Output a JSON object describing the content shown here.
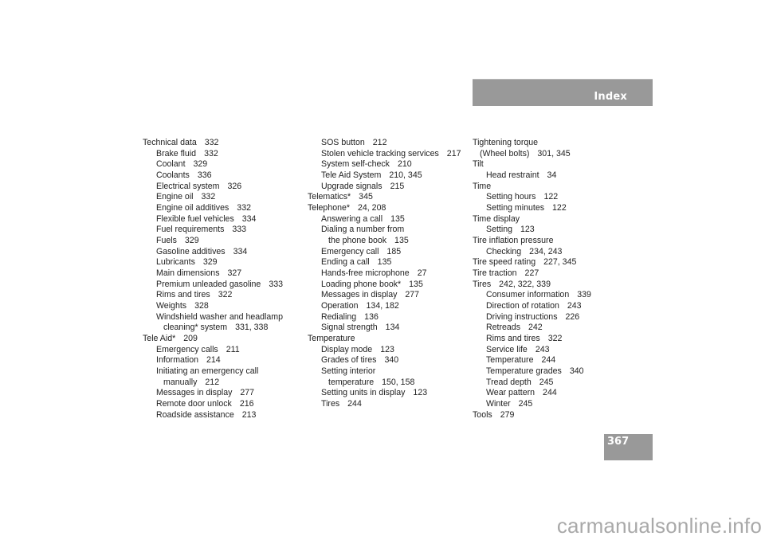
{
  "header": {
    "title": "Index"
  },
  "page_number": "367",
  "watermark": "carmanualsonline.info",
  "columns": [
    [
      {
        "level": 0,
        "text": "Technical data",
        "pages": "332"
      },
      {
        "level": 1,
        "text": "Brake fluid",
        "pages": "332"
      },
      {
        "level": 1,
        "text": "Coolant",
        "pages": "329"
      },
      {
        "level": 1,
        "text": "Coolants",
        "pages": "336"
      },
      {
        "level": 1,
        "text": "Electrical system",
        "pages": "326"
      },
      {
        "level": 1,
        "text": "Engine oil",
        "pages": "332"
      },
      {
        "level": 1,
        "text": "Engine oil additives",
        "pages": "332"
      },
      {
        "level": 1,
        "text": "Flexible fuel vehicles",
        "pages": "334"
      },
      {
        "level": 1,
        "text": "Fuel requirements",
        "pages": "333"
      },
      {
        "level": 1,
        "text": "Fuels",
        "pages": "329"
      },
      {
        "level": 1,
        "text": "Gasoline additives",
        "pages": "334"
      },
      {
        "level": 1,
        "text": "Lubricants",
        "pages": "329"
      },
      {
        "level": 1,
        "text": "Main dimensions",
        "pages": "327"
      },
      {
        "level": 1,
        "text": "Premium unleaded gasoline",
        "pages": "333"
      },
      {
        "level": 1,
        "text": "Rims and tires",
        "pages": "322"
      },
      {
        "level": 1,
        "text": "Weights",
        "pages": "328"
      },
      {
        "level": 1,
        "text": "Windshield washer and headlamp",
        "pages": ""
      },
      {
        "level": 2,
        "text": "cleaning* system",
        "pages": "331, 338"
      },
      {
        "level": 0,
        "text": "Tele Aid*",
        "pages": "209"
      },
      {
        "level": 1,
        "text": "Emergency calls",
        "pages": "211"
      },
      {
        "level": 1,
        "text": "Information",
        "pages": "214"
      },
      {
        "level": 1,
        "text": "Initiating an emergency call",
        "pages": ""
      },
      {
        "level": 2,
        "text": "manually",
        "pages": "212"
      },
      {
        "level": 1,
        "text": "Messages in display",
        "pages": "277"
      },
      {
        "level": 1,
        "text": "Remote door unlock",
        "pages": "216"
      },
      {
        "level": 1,
        "text": "Roadside assistance",
        "pages": "213"
      }
    ],
    [
      {
        "level": 1,
        "text": "SOS button",
        "pages": "212"
      },
      {
        "level": 1,
        "text": "Stolen vehicle tracking services",
        "pages": "217"
      },
      {
        "level": 1,
        "text": "System self-check",
        "pages": "210"
      },
      {
        "level": 1,
        "text": "Tele Aid System",
        "pages": "210, 345"
      },
      {
        "level": 1,
        "text": "Upgrade signals",
        "pages": "215"
      },
      {
        "level": 0,
        "text": "Telematics*",
        "pages": "345"
      },
      {
        "level": 0,
        "text": "Telephone*",
        "pages": "24, 208"
      },
      {
        "level": 1,
        "text": "Answering a call",
        "pages": "135"
      },
      {
        "level": 1,
        "text": "Dialing a number from",
        "pages": ""
      },
      {
        "level": 2,
        "text": "the phone book",
        "pages": "135"
      },
      {
        "level": 1,
        "text": "Emergency call",
        "pages": "185"
      },
      {
        "level": 1,
        "text": "Ending a call",
        "pages": "135"
      },
      {
        "level": 1,
        "text": "Hands-free microphone",
        "pages": "27"
      },
      {
        "level": 1,
        "text": "Loading phone book*",
        "pages": "135"
      },
      {
        "level": 1,
        "text": "Messages in display",
        "pages": "277"
      },
      {
        "level": 1,
        "text": "Operation",
        "pages": "134, 182"
      },
      {
        "level": 1,
        "text": "Redialing",
        "pages": "136"
      },
      {
        "level": 1,
        "text": "Signal strength",
        "pages": "134"
      },
      {
        "level": 0,
        "text": "Temperature",
        "pages": ""
      },
      {
        "level": 1,
        "text": "Display mode",
        "pages": "123"
      },
      {
        "level": 1,
        "text": "Grades of tires",
        "pages": "340"
      },
      {
        "level": 1,
        "text": "Setting interior",
        "pages": ""
      },
      {
        "level": 2,
        "text": "temperature",
        "pages": "150, 158"
      },
      {
        "level": 1,
        "text": "Setting units in display",
        "pages": "123"
      },
      {
        "level": 1,
        "text": "Tires",
        "pages": "244"
      }
    ],
    [
      {
        "level": 0,
        "text": "Tightening torque",
        "pages": ""
      },
      {
        "level": "h",
        "text": "(Wheel bolts)",
        "pages": "301, 345"
      },
      {
        "level": 0,
        "text": "Tilt",
        "pages": ""
      },
      {
        "level": 1,
        "text": "Head restraint",
        "pages": "34"
      },
      {
        "level": 0,
        "text": "Time",
        "pages": ""
      },
      {
        "level": 1,
        "text": "Setting hours",
        "pages": "122"
      },
      {
        "level": 1,
        "text": "Setting minutes",
        "pages": "122"
      },
      {
        "level": 0,
        "text": "Time display",
        "pages": ""
      },
      {
        "level": 1,
        "text": "Setting",
        "pages": "123"
      },
      {
        "level": 0,
        "text": "Tire inflation pressure",
        "pages": ""
      },
      {
        "level": 1,
        "text": "Checking",
        "pages": "234, 243"
      },
      {
        "level": 0,
        "text": "Tire speed rating",
        "pages": "227, 345"
      },
      {
        "level": 0,
        "text": "Tire traction",
        "pages": "227"
      },
      {
        "level": 0,
        "text": "Tires",
        "pages": "242, 322, 339"
      },
      {
        "level": 1,
        "text": "Consumer information",
        "pages": "339"
      },
      {
        "level": 1,
        "text": "Direction of rotation",
        "pages": "243"
      },
      {
        "level": 1,
        "text": "Driving instructions",
        "pages": "226"
      },
      {
        "level": 1,
        "text": "Retreads",
        "pages": "242"
      },
      {
        "level": 1,
        "text": "Rims and tires",
        "pages": "322"
      },
      {
        "level": 1,
        "text": "Service life",
        "pages": "243"
      },
      {
        "level": 1,
        "text": "Temperature",
        "pages": "244"
      },
      {
        "level": 1,
        "text": "Temperature grades",
        "pages": "340"
      },
      {
        "level": 1,
        "text": "Tread depth",
        "pages": "245"
      },
      {
        "level": 1,
        "text": "Wear pattern",
        "pages": "244"
      },
      {
        "level": 1,
        "text": "Winter",
        "pages": "245"
      },
      {
        "level": 0,
        "text": "Tools",
        "pages": "279"
      }
    ]
  ]
}
